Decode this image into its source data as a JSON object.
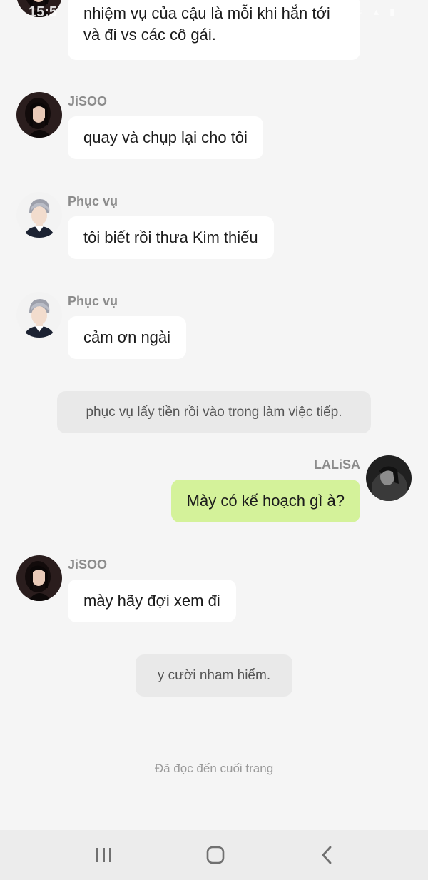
{
  "status_bar": {
    "time": "15:5",
    "icons": [
      "wifi-icon",
      "signal-icon",
      "battery-icon"
    ]
  },
  "messages": [
    {
      "sender": "",
      "text": "nhiệm vụ của cậu là mỗi khi hắn tới và đi vs các cô gái.",
      "avatar": "jisoo-avatar"
    },
    {
      "sender": "JiSOO",
      "text": "quay và chụp lại cho tôi",
      "avatar": "jisoo-avatar"
    },
    {
      "sender": "Phục vụ",
      "text": "tôi biết rồi thưa Kim thiếu",
      "avatar": "phuc-vu-avatar"
    },
    {
      "sender": "Phục vụ",
      "text": "cảm ơn ngài",
      "avatar": "phuc-vu-avatar"
    },
    {
      "narration": "phục vụ lấy tiền rồi vào trong làm việc tiếp."
    },
    {
      "sender": "LALiSA",
      "text": "Mày có kế hoạch gì à?",
      "avatar": "lalisa-avatar",
      "mine": true
    },
    {
      "sender": "JiSOO",
      "text": "mày hãy đợi xem đi",
      "avatar": "jisoo-avatar"
    },
    {
      "narration": "y cười nham hiểm."
    }
  ],
  "end_note": "Đã đọc đến cuối trang",
  "nav_bar": {
    "buttons": [
      "recent-apps-icon",
      "home-icon",
      "back-icon"
    ]
  },
  "colors": {
    "background": "#f5f5f5",
    "bubble": "#ffffff",
    "my_bubble": "#d4f29a",
    "narration": "#e9e9e9",
    "sender_name": "#8c8c8c"
  }
}
